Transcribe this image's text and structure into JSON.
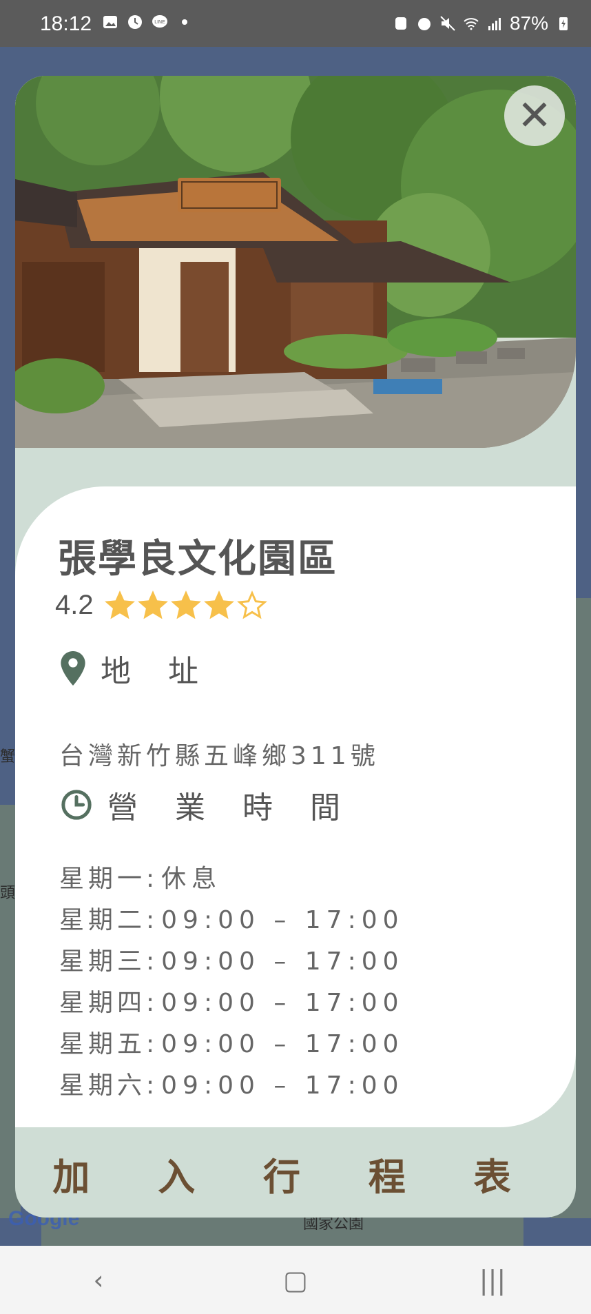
{
  "status_bar": {
    "time": "18:12",
    "battery": "87%",
    "left_icons": [
      "gallery-icon",
      "clock-icon",
      "line-chat-icon",
      "dot-icon"
    ],
    "right_icons": [
      "nfc-icon",
      "alarm-icon",
      "mute-icon",
      "wifi-icon",
      "signal-icon",
      "battery-charging-icon"
    ]
  },
  "map": {
    "google_logo": "Google",
    "labels": [
      "蟹",
      "頭",
      "國家公園"
    ]
  },
  "place": {
    "name": "張學良文化園區",
    "rating": "4.2",
    "rating_value": 4.2,
    "rating_max": 5
  },
  "address_section": {
    "title": "地 址",
    "icon": "location-pin-icon",
    "value": "台灣新竹縣五峰鄉311號"
  },
  "hours_section": {
    "title": "營 業 時 間",
    "icon": "clock-icon",
    "rows": [
      {
        "day": "星期一:",
        "time": "休息"
      },
      {
        "day": "星期二:",
        "time": "09:00 – 17:00"
      },
      {
        "day": "星期三:",
        "time": "09:00 – 17:00"
      },
      {
        "day": "星期四:",
        "time": "09:00 – 17:00"
      },
      {
        "day": "星期五:",
        "time": "09:00 – 17:00"
      },
      {
        "day": "星期六:",
        "time": "09:00 – 17:00"
      }
    ]
  },
  "actions": {
    "add_to_itinerary": "加 入 行 程 表",
    "close_glyph": "✕"
  },
  "nav_bar": {
    "back": "‹",
    "home": "▢",
    "recents": "|||"
  },
  "colors": {
    "accent": "#cfddd5",
    "button_text": "#6b4f33",
    "star": "#f7c04a"
  }
}
